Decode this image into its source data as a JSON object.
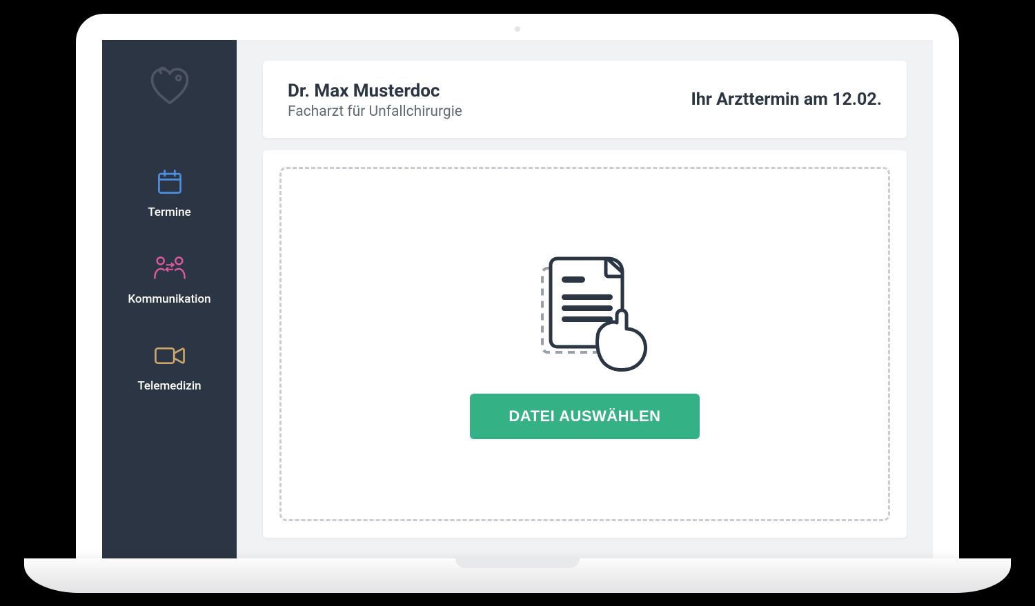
{
  "sidebar": {
    "items": [
      {
        "label": "Termine"
      },
      {
        "label": "Kommunikation"
      },
      {
        "label": "Telemedizin"
      }
    ]
  },
  "header": {
    "doctor_name": "Dr. Max Musterdoc",
    "doctor_specialty": "Facharzt für Unfallchirurgie",
    "appointment_text": "Ihr Arzttermin am 12.02."
  },
  "upload": {
    "button_label": "DATEI AUSWÄHLEN"
  },
  "colors": {
    "sidebar_bg": "#2c3543",
    "accent_green": "#34b286",
    "icon_blue": "#4a8fe0",
    "icon_pink": "#d85a9a",
    "icon_tan": "#caa66d"
  }
}
